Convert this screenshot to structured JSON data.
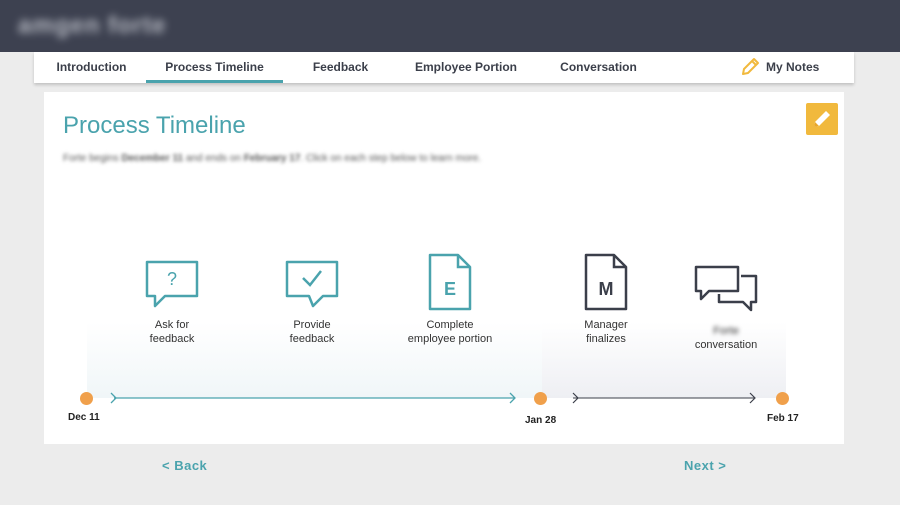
{
  "header": {
    "logo_text": "amgen forte"
  },
  "nav": {
    "tabs": [
      {
        "label": "Introduction"
      },
      {
        "label": "Process Timeline",
        "active": true
      },
      {
        "label": "Feedback"
      },
      {
        "label": "Employee Portion"
      },
      {
        "label": "Conversation"
      }
    ],
    "notes_label": "My Notes"
  },
  "main": {
    "title": "Process Timeline",
    "subtitle_parts": {
      "a": "Forte begins ",
      "start": "December 11",
      "b": " and ends on ",
      "end": "February 17",
      "c": ". Click on each step below to learn more."
    }
  },
  "timeline": {
    "steps": [
      {
        "icon": "question-bubble-icon",
        "line1": "Ask for",
        "line2": "feedback"
      },
      {
        "icon": "check-bubble-icon",
        "line1": "Provide",
        "line2": "feedback"
      },
      {
        "icon": "employee-document-icon",
        "letter": "E",
        "line1": "Complete",
        "line2": "employee portion"
      },
      {
        "icon": "manager-document-icon",
        "letter": "M",
        "line1": "Manager",
        "line2": "finalizes"
      },
      {
        "icon": "conversation-bubbles-icon",
        "line1": "Forte",
        "line2": "conversation"
      }
    ],
    "dates": [
      "Dec 11",
      "Jan 28",
      "Feb 17"
    ]
  },
  "footer": {
    "back_label": "< Back",
    "next_label": "Next >"
  },
  "colors": {
    "teal": "#4aa3ad",
    "dark": "#3b3f4a",
    "orange": "#f0a04b",
    "gold": "#f1b93d",
    "topbar": "#3d4150"
  }
}
